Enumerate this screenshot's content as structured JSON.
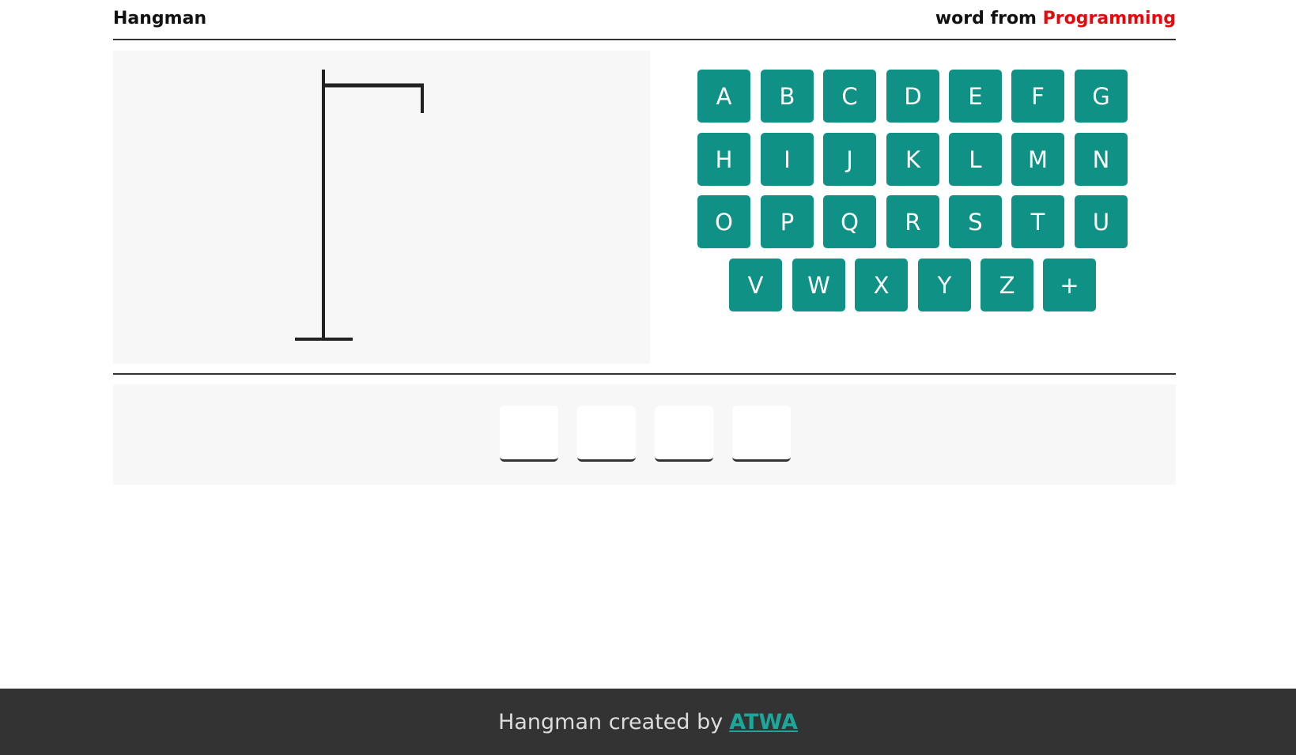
{
  "header": {
    "title": "Hangman",
    "category_prefix": "word from",
    "category_name": "Programming"
  },
  "keyboard": {
    "rows": [
      [
        "A",
        "B",
        "C",
        "D",
        "E",
        "F",
        "G"
      ],
      [
        "H",
        "I",
        "J",
        "K",
        "L",
        "M",
        "N"
      ],
      [
        "O",
        "P",
        "Q",
        "R",
        "S",
        "T",
        "U"
      ],
      [
        "V",
        "W",
        "X",
        "Y",
        "Z",
        "+"
      ]
    ]
  },
  "word": {
    "slots": [
      "",
      "",
      "",
      ""
    ]
  },
  "footer": {
    "text": "Hangman created by",
    "author": "ATWA"
  },
  "colors": {
    "key_bg": "#0f9285",
    "category": "#e5090c",
    "footer_bg": "#333333",
    "author_link": "#1aa89b"
  }
}
